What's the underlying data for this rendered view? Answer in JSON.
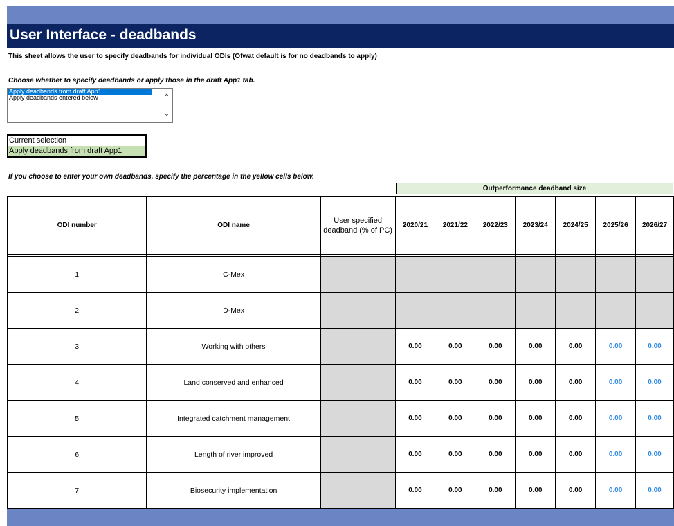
{
  "title": "User Interface - deadbands",
  "description": "This sheet allows the user to specify deadbands for individual ODIs (Ofwat default is for no deadbands to apply)",
  "choose_prompt": "Choose whether to specify deadbands or apply those in the draft App1 tab.",
  "listbox": {
    "options": [
      "Apply deadbands from draft App1",
      "Apply deadbands entered below"
    ],
    "selected_index": 0
  },
  "current_selection": {
    "label": "Current selection",
    "value": "Apply deadbands from draft App1"
  },
  "own_deadbands_note": "If you choose to enter your own deadbands, specify the percentage in the yellow cells below.",
  "table": {
    "group_header": "Outperformance deadband size",
    "headers": {
      "odi_number": "ODI number",
      "odi_name": "ODI name",
      "user_specified": "User specified deadband (% of PC)"
    },
    "years": [
      "2020/21",
      "2021/22",
      "2022/23",
      "2023/24",
      "2024/25",
      "2025/26",
      "2026/27"
    ],
    "rows": [
      {
        "number": "1",
        "name": "C-Mex",
        "values": [
          "",
          "",
          "",
          "",
          "",
          "",
          ""
        ]
      },
      {
        "number": "2",
        "name": "D-Mex",
        "values": [
          "",
          "",
          "",
          "",
          "",
          "",
          ""
        ]
      },
      {
        "number": "3",
        "name": "Working with others",
        "values": [
          "0.00",
          "0.00",
          "0.00",
          "0.00",
          "0.00",
          "0.00",
          "0.00"
        ]
      },
      {
        "number": "4",
        "name": "Land conserved and enhanced",
        "values": [
          "0.00",
          "0.00",
          "0.00",
          "0.00",
          "0.00",
          "0.00",
          "0.00"
        ]
      },
      {
        "number": "5",
        "name": "Integrated catchment management",
        "values": [
          "0.00",
          "0.00",
          "0.00",
          "0.00",
          "0.00",
          "0.00",
          "0.00"
        ]
      },
      {
        "number": "6",
        "name": "Length of river improved",
        "values": [
          "0.00",
          "0.00",
          "0.00",
          "0.00",
          "0.00",
          "0.00",
          "0.00"
        ]
      },
      {
        "number": "7",
        "name": "Biosecurity implementation",
        "values": [
          "0.00",
          "0.00",
          "0.00",
          "0.00",
          "0.00",
          "0.00",
          "0.00"
        ]
      }
    ]
  },
  "colors": {
    "band": "#6a84c4",
    "title_bar": "#0c2461",
    "selection_fill": "#c6e0b4",
    "group_header_fill": "#e2efda",
    "grey_cell": "#d9d9d9",
    "blue_value": "#2e8be6"
  },
  "icons": {
    "scroll_up": "chevron-up-icon",
    "scroll_down": "chevron-down-icon"
  }
}
